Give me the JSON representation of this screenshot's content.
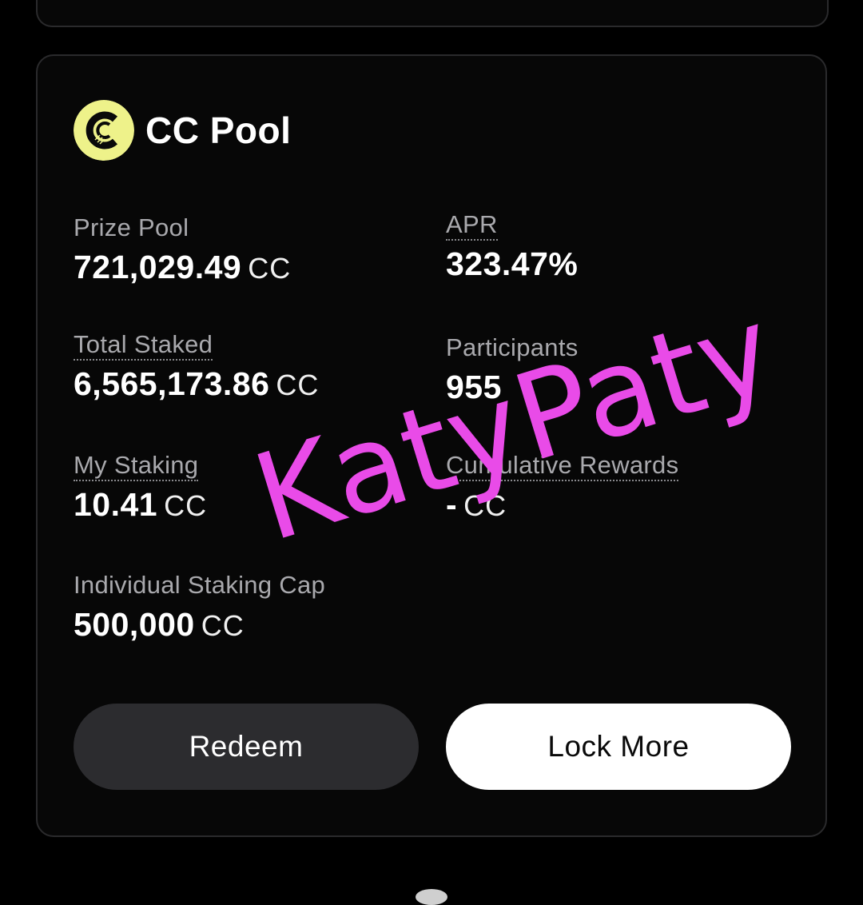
{
  "pool": {
    "title": "CC Pool",
    "logo_icon": "cc-coin-logo",
    "accent_color": "#eef28a"
  },
  "stats": {
    "prize_pool": {
      "label": "Prize Pool",
      "value": "721,029.49",
      "unit": "CC"
    },
    "apr": {
      "label": "APR",
      "value": "323.47%"
    },
    "total_staked": {
      "label": "Total Staked",
      "value": "6,565,173.86",
      "unit": "CC"
    },
    "participants": {
      "label": "Participants",
      "value": "955"
    },
    "my_staking": {
      "label": "My Staking",
      "value": "10.41",
      "unit": "CC"
    },
    "cumulative_rewards": {
      "label": "Cumulative Rewards",
      "value": "-",
      "unit": "CC"
    },
    "individual_cap": {
      "label": "Individual Staking Cap",
      "value": "500,000",
      "unit": "CC"
    }
  },
  "actions": {
    "redeem_label": "Redeem",
    "lock_more_label": "Lock More"
  },
  "watermark": {
    "text": "KatyPaty",
    "color": "#e94be8"
  }
}
